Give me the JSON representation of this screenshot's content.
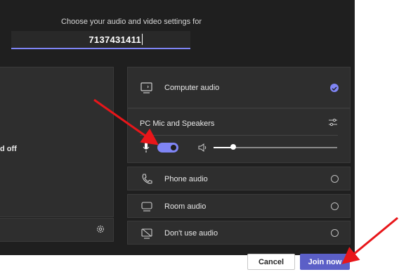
{
  "header": {
    "prompt": "Choose your audio and video settings for",
    "meeting_name": "7137431411"
  },
  "video": {
    "status_text": "d off",
    "settings_icon": "gear-icon"
  },
  "audio_options": [
    {
      "label": "Computer audio",
      "icon": "computer-audio-icon",
      "selected": true
    },
    {
      "label": "Phone audio",
      "icon": "phone-icon",
      "selected": false
    },
    {
      "label": "Room audio",
      "icon": "room-icon",
      "selected": false
    },
    {
      "label": "Don't use audio",
      "icon": "no-audio-icon",
      "selected": false
    }
  ],
  "device": {
    "label": "PC Mic and Speakers",
    "mic_on": true,
    "volume_level": 0.16
  },
  "buttons": {
    "cancel": "Cancel",
    "join": "Join now"
  },
  "colors": {
    "accent": "#7f85f5",
    "join": "#5b5fc7",
    "annotation_arrow": "#e8161a"
  }
}
